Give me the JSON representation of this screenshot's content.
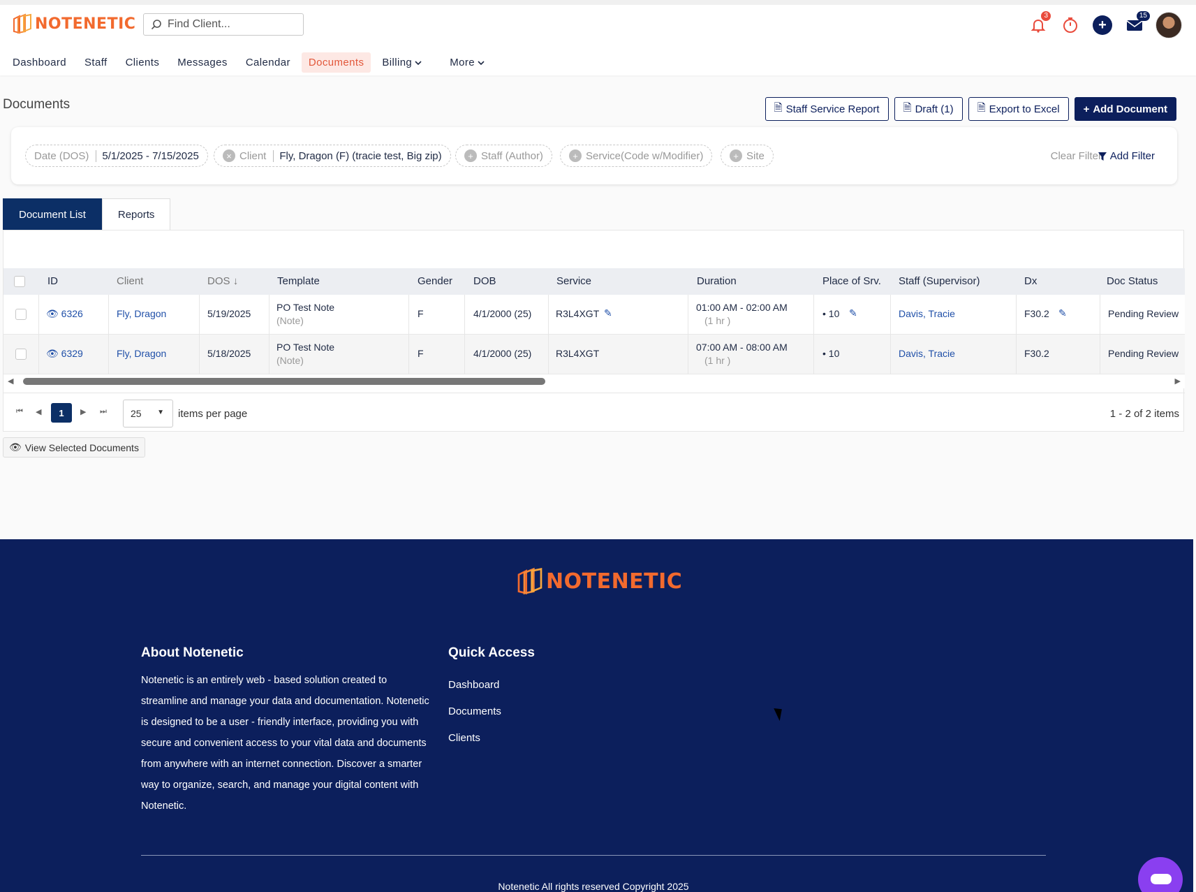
{
  "brand": {
    "name": "NOTENETIC",
    "color": "#f26a2e"
  },
  "search": {
    "placeholder": "Find Client..."
  },
  "topbar": {
    "notifications_count": "3",
    "messages_count": "15"
  },
  "nav": {
    "items": [
      {
        "label": "Dashboard"
      },
      {
        "label": "Staff"
      },
      {
        "label": "Clients"
      },
      {
        "label": "Messages"
      },
      {
        "label": "Calendar"
      },
      {
        "label": "Documents"
      },
      {
        "label": "Billing"
      },
      {
        "label": "More"
      }
    ],
    "active": "Documents"
  },
  "page": {
    "title": "Documents"
  },
  "actions": {
    "staff_service_report": "Staff Service Report",
    "draft": "Draft (1)",
    "export": "Export to Excel",
    "add_document": "Add Document"
  },
  "filters": {
    "date_label": "Date (DOS)",
    "date_value": "5/1/2025 - 7/15/2025",
    "client_label": "Client",
    "client_value": "Fly, Dragon (F) (tracie test, Big zip)",
    "staff": "Staff (Author)",
    "service": "Service(Code w/Modifier)",
    "site": "Site",
    "clear": "Clear Filter",
    "add": "Add Filter"
  },
  "tabs": [
    {
      "label": "Document List"
    },
    {
      "label": "Reports"
    }
  ],
  "table": {
    "columns": [
      "ID",
      "Client",
      "DOS",
      "Template",
      "Gender",
      "DOB",
      "Service",
      "Duration",
      "Place of Srv.",
      "Staff (Supervisor)",
      "Dx",
      "Doc Status"
    ],
    "rows": [
      {
        "id": "6326",
        "client": "Fly, Dragon",
        "dos": "5/19/2025",
        "template": "PO Test Note",
        "template_sub": "(Note)",
        "gender": "F",
        "dob": "4/1/2000 (25)",
        "service": "R3L4XGT",
        "duration": "01:00 AM - 02:00 AM",
        "duration_sub": "(1 hr )",
        "place": "10",
        "staff": "Davis, Tracie",
        "dx": "F30.2",
        "status": "Pending Review"
      },
      {
        "id": "6329",
        "client": "Fly, Dragon",
        "dos": "5/18/2025",
        "template": "PO Test Note",
        "template_sub": "(Note)",
        "gender": "F",
        "dob": "4/1/2000 (25)",
        "service": "R3L4XGT",
        "duration": "07:00 AM - 08:00 AM",
        "duration_sub": "(1 hr )",
        "place": "10",
        "staff": "Davis, Tracie",
        "dx": "F30.2",
        "status": "Pending Review"
      }
    ]
  },
  "pager": {
    "page": "1",
    "page_size": "25",
    "per_page_label": "items per page",
    "info": "1 - 2 of 2 items"
  },
  "view_selected": "View Selected Documents",
  "footer": {
    "about_title": "About Notenetic",
    "about_text": "Notenetic is an entirely web - based solution created to streamline and manage your data and documentation. Notenetic is designed to be a user - friendly interface, providing you with secure and convenient access to your vital data and documents from anywhere with an internet connection. Discover a smarter way to organize, search, and manage your digital content with Notenetic.",
    "quick_title": "Quick Access",
    "quick_links": [
      "Dashboard",
      "Documents",
      "Clients"
    ],
    "copyright": "Notenetic All rights reserved Copyright 2025",
    "bg_color": "#0c1f5c"
  }
}
